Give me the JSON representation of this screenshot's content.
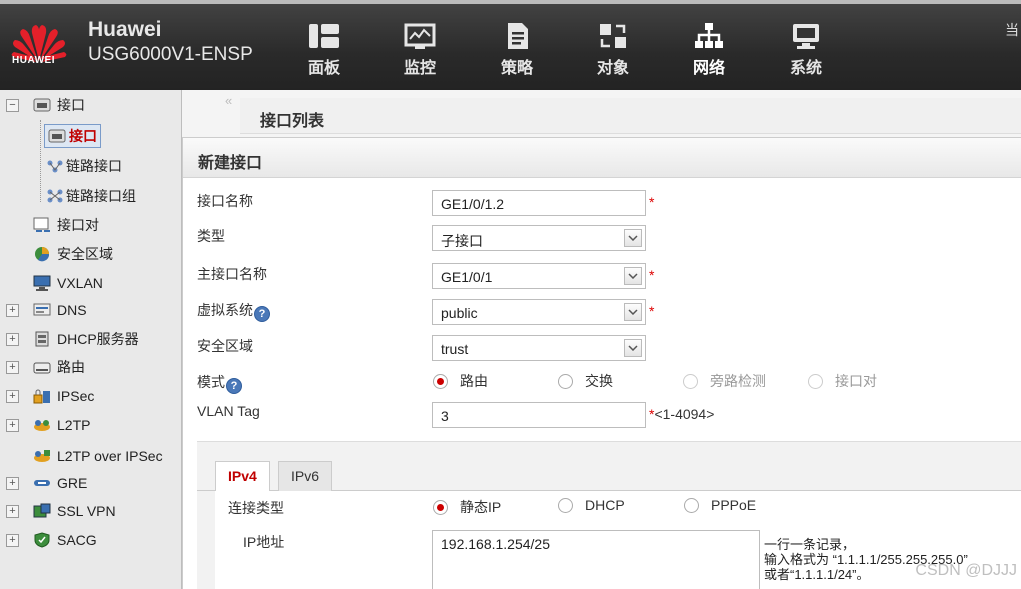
{
  "header": {
    "logo_text": "HUAWEI",
    "brand_name": "Huawei",
    "device_model": "USG6000V1-ENSP",
    "nav": [
      {
        "label": "面板",
        "icon": "dashboard-icon"
      },
      {
        "label": "监控",
        "icon": "monitor-icon"
      },
      {
        "label": "策略",
        "icon": "policy-icon"
      },
      {
        "label": "对象",
        "icon": "object-icon"
      },
      {
        "label": "网络",
        "icon": "network-icon",
        "active": true
      },
      {
        "label": "系统",
        "icon": "system-icon"
      }
    ],
    "top_right": "当"
  },
  "sidebar": {
    "collapse": "«",
    "items": [
      {
        "label": "接口",
        "expand": "−"
      },
      {
        "label": "接口",
        "selected": true
      },
      {
        "label": "链路接口"
      },
      {
        "label": "链路接口组"
      },
      {
        "label": "接口对"
      },
      {
        "label": "安全区域"
      },
      {
        "label": "VXLAN"
      },
      {
        "label": "DNS",
        "expand": "+"
      },
      {
        "label": "DHCP服务器",
        "expand": "+"
      },
      {
        "label": "路由",
        "expand": "+"
      },
      {
        "label": "IPSec",
        "expand": "+"
      },
      {
        "label": "L2TP",
        "expand": "+"
      },
      {
        "label": "L2TP over IPSec"
      },
      {
        "label": "GRE",
        "expand": "+"
      },
      {
        "label": "SSL VPN",
        "expand": "+"
      },
      {
        "label": "SACG",
        "expand": "+"
      }
    ]
  },
  "main": {
    "list_title": "接口列表"
  },
  "dialog": {
    "title": "新建接口",
    "fields": {
      "interface_name": {
        "label": "接口名称",
        "value": "GE1/0/1.2",
        "required": "*"
      },
      "type": {
        "label": "类型",
        "value": "子接口"
      },
      "main_interface": {
        "label": "主接口名称",
        "value": "GE1/0/1",
        "required": "*"
      },
      "virtual_system": {
        "label": "虚拟系统",
        "help": "?",
        "value": "public",
        "required": "*"
      },
      "security_zone": {
        "label": "安全区域",
        "value": "trust"
      },
      "mode": {
        "label": "模式",
        "help": "?",
        "options": [
          "路由",
          "交换",
          "旁路检测",
          "接口对"
        ],
        "selected": "路由"
      },
      "vlan_tag": {
        "label": "VLAN Tag",
        "value": "3",
        "hint": "*<1-4094>"
      }
    },
    "tabs": [
      "IPv4",
      "IPv6"
    ],
    "active_tab": "IPv4",
    "ipv4": {
      "conn_type_label": "连接类型",
      "conn_options": [
        "静态IP",
        "DHCP",
        "PPPoE"
      ],
      "conn_selected": "静态IP",
      "ip_label": "IP地址",
      "ip_value": "192.168.1.254/25",
      "hint_line1": "一行一条记录，",
      "hint_line2": "输入格式为 “1.1.1.1/255.255.255.0”",
      "hint_line3": "或者“1.1.1.1/24”。"
    }
  },
  "watermark": "CSDN @DJJJ",
  "colors": {
    "accent_red": "#c00000",
    "header_bg": "#2a2a2a",
    "help_blue": "#4a78b8"
  }
}
